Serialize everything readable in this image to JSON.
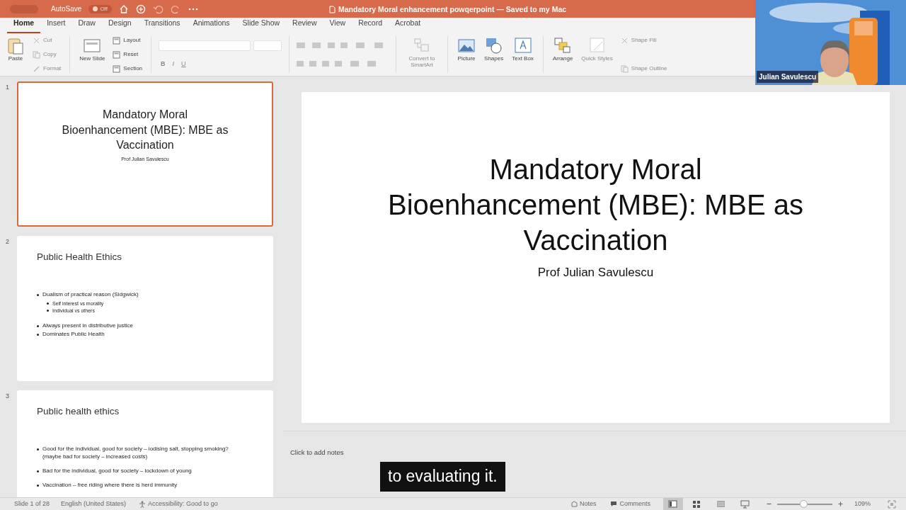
{
  "title_bar": {
    "autosave_label": "AutoSave",
    "autosave_toggle": {
      "label": "Off",
      "on": false
    },
    "title": "Mandatory Moral enhancement powqerpoint — Saved to my Mac"
  },
  "tabs": [
    {
      "label": "Home",
      "selected": true
    },
    {
      "label": "Insert",
      "selected": false
    },
    {
      "label": "Draw",
      "selected": false
    },
    {
      "label": "Design",
      "selected": false
    },
    {
      "label": "Transitions",
      "selected": false
    },
    {
      "label": "Animations",
      "selected": false
    },
    {
      "label": "Slide Show",
      "selected": false
    },
    {
      "label": "Review",
      "selected": false
    },
    {
      "label": "View",
      "selected": false
    },
    {
      "label": "Record",
      "selected": false
    },
    {
      "label": "Acrobat",
      "selected": false
    }
  ],
  "ribbon": {
    "columns": [
      {
        "items": [
          {
            "label": "Paste",
            "kind": "large",
            "disabled": false
          }
        ],
        "divider_after": false
      },
      {
        "items": [
          {
            "label": "Cut",
            "kind": "small",
            "disabled": true
          },
          {
            "label": "Copy",
            "kind": "small",
            "disabled": true
          },
          {
            "label": "Format",
            "kind": "small",
            "disabled": true
          }
        ],
        "divider_after": true
      },
      {
        "items": [
          {
            "label": "New Slide",
            "kind": "large",
            "disabled": false
          }
        ],
        "divider_after": false
      },
      {
        "items": [
          {
            "label": "Layout",
            "kind": "small",
            "disabled": false
          },
          {
            "label": "Reset",
            "kind": "small",
            "disabled": false
          },
          {
            "label": "Section",
            "kind": "small",
            "disabled": false
          }
        ],
        "divider_after": true
      },
      {
        "items": [
          {
            "label": "B",
            "kind": "font",
            "disabled": true
          },
          {
            "label": "I",
            "kind": "font",
            "disabled": true
          },
          {
            "label": "U",
            "kind": "font",
            "disabled": true
          }
        ],
        "divider_after": true
      },
      {
        "items": [
          {
            "label": "Convert to SmartArt",
            "kind": "large",
            "disabled": true
          }
        ],
        "divider_after": true
      },
      {
        "items": [
          {
            "label": "Picture",
            "kind": "large",
            "disabled": false
          }
        ],
        "divider_after": false
      },
      {
        "items": [
          {
            "label": "Shapes",
            "kind": "large",
            "disabled": false
          }
        ],
        "divider_after": false
      },
      {
        "items": [
          {
            "label": "Text Box",
            "kind": "large",
            "disabled": false
          }
        ],
        "divider_after": true
      },
      {
        "items": [
          {
            "label": "Arrange",
            "kind": "large",
            "disabled": false
          }
        ],
        "divider_after": false
      },
      {
        "items": [
          {
            "label": "Quick Styles",
            "kind": "large",
            "disabled": true
          }
        ],
        "divider_after": false
      },
      {
        "items": [
          {
            "label": "Shape Fill",
            "kind": "small",
            "disabled": true
          },
          {
            "label": "Shape Outline",
            "kind": "small",
            "disabled": true
          }
        ],
        "divider_after": false
      }
    ]
  },
  "slide_thumbnails": [
    {
      "number": "1",
      "selected": true,
      "kind": "title",
      "title_lines": [
        "Mandatory Moral",
        "Bioenhancement (MBE): MBE as",
        "Vaccination"
      ],
      "subtitle": "Prof Julian Savulescu"
    },
    {
      "number": "2",
      "selected": false,
      "kind": "content",
      "title": "Public Health Ethics",
      "bullet_groups": [
        [
          {
            "text": "Dualism of practical reason (Sidgwick)",
            "children": [
              {
                "text": "Self interest vs morality"
              },
              {
                "text": "Individual vs others"
              }
            ]
          }
        ],
        [
          {
            "text": "Always present in distributive justice"
          },
          {
            "text": "Dominates Public Health"
          }
        ]
      ]
    },
    {
      "number": "3",
      "selected": false,
      "kind": "content",
      "title": "Public health ethics",
      "bullet_groups": [
        [
          {
            "text": "Good for the individual, good for society – iodising salt, stopping smoking? (maybe bad for society – increased costs)"
          }
        ],
        [
          {
            "text": "Bad for the individual, good for society – lockdown of young"
          }
        ],
        [
          {
            "text": "Vaccination – free riding where there is herd immunity"
          }
        ]
      ]
    }
  ],
  "current_slide": {
    "title_lines": [
      "Mandatory Moral",
      "Bioenhancement (MBE): MBE as",
      "Vaccination"
    ],
    "subtitle": "Prof Julian Savulescu"
  },
  "notes": {
    "placeholder": "Click to add notes"
  },
  "caption": "to evaluating it.",
  "video": {
    "kind": "picture",
    "participant_name": "Julian Savulescu"
  },
  "status_bar": {
    "slide_position": "Slide 1 of 28",
    "language": "English (United States)",
    "accessibility": "Accessibility: Good to go",
    "notes_button": "Notes",
    "comments_button": "Comments",
    "views": [
      {
        "selected": true
      },
      {
        "selected": false
      },
      {
        "selected": false
      },
      {
        "selected": false
      }
    ],
    "zoom": {
      "level": 0.48,
      "reading": "109%"
    }
  }
}
